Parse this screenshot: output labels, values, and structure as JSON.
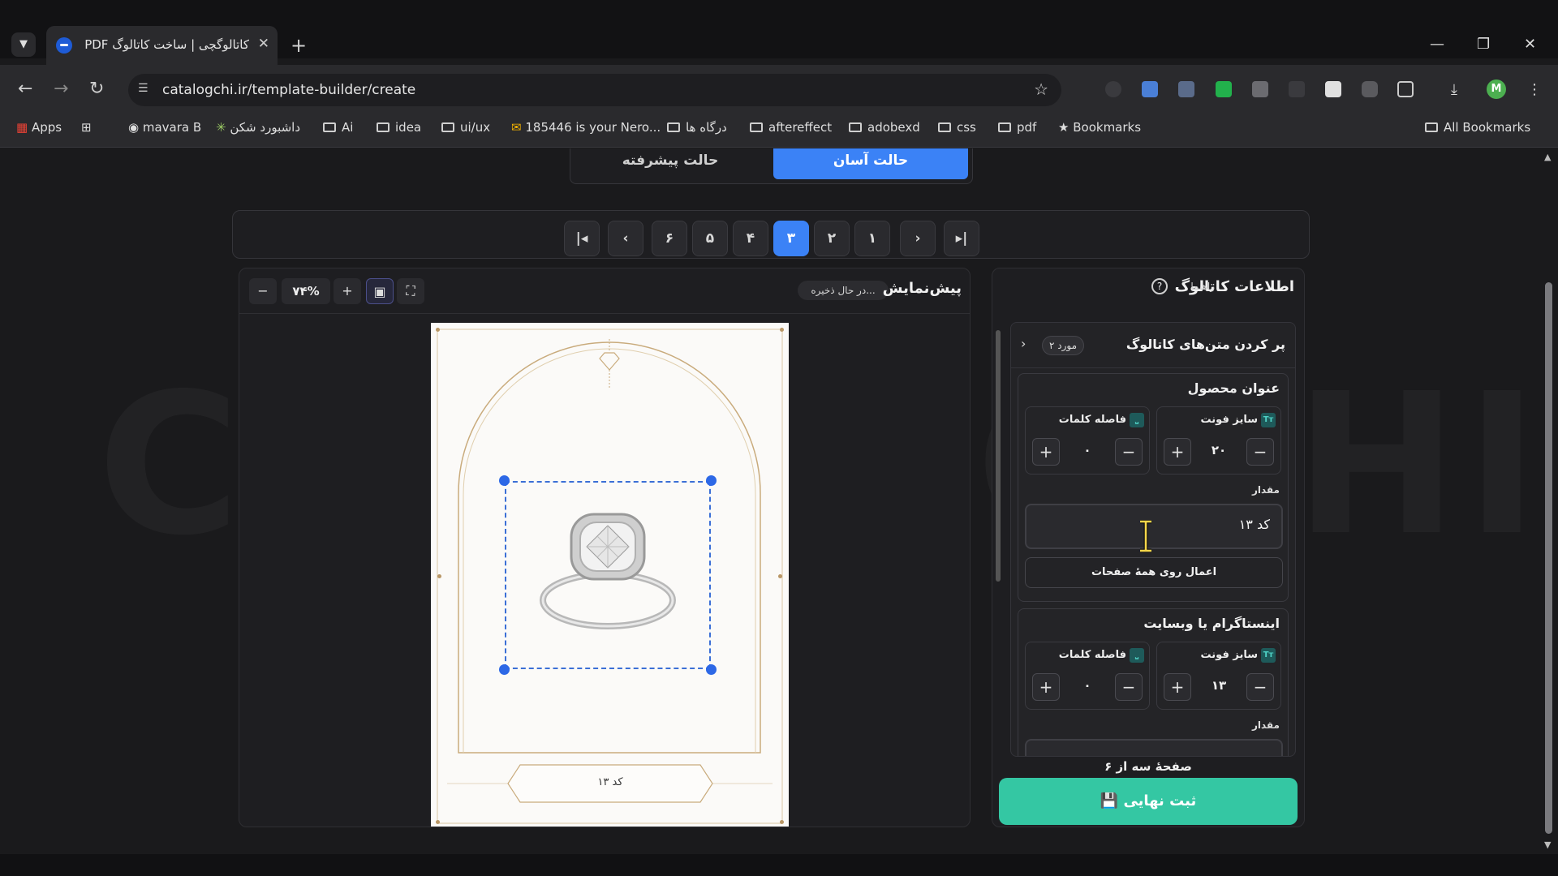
{
  "browser": {
    "tab_title": "کاتالوگچی | ساخت کاتالوگ PDF",
    "tab_close": "✕",
    "new_tab": "+",
    "url": "catalogchi.ir/template-builder/create",
    "profile_initial": "M",
    "window_controls": {
      "minimize": "—",
      "restore": "❐",
      "close": "✕"
    },
    "bookmarks": [
      {
        "label": "Apps",
        "icon": "apps-grid-icon"
      },
      {
        "label": "",
        "icon": "grid-icon"
      },
      {
        "label": "mavara B",
        "icon": "globe-icon"
      },
      {
        "label": "داشبورد شکن",
        "icon": "shekan-icon"
      },
      {
        "label": "Ai",
        "icon": "folder-icon"
      },
      {
        "label": "idea",
        "icon": "folder-icon"
      },
      {
        "label": "ui/ux",
        "icon": "folder-icon"
      },
      {
        "label": "185446 is your Nero...",
        "icon": "mail-icon"
      },
      {
        "label": "درگاه ها",
        "icon": "folder-icon"
      },
      {
        "label": "aftereffect",
        "icon": "folder-icon"
      },
      {
        "label": "adobexd",
        "icon": "folder-icon"
      },
      {
        "label": "css",
        "icon": "folder-icon"
      },
      {
        "label": "pdf",
        "icon": "folder-icon"
      },
      {
        "label": "Bookmarks",
        "icon": "star-icon"
      }
    ],
    "all_bookmarks": "All Bookmarks"
  },
  "app": {
    "watermark": "CATALOGCHI.IR",
    "mode_toggle": {
      "advanced": "حالت پیشرفته",
      "easy": "حالت آسان",
      "active": "easy"
    },
    "pager": {
      "pages": [
        "۱",
        "۲",
        "۳",
        "۴",
        "۵",
        "۶"
      ],
      "active_page": "۳"
    },
    "preview": {
      "title": "پیش‌نمایش",
      "saving_status": "در حال ذخیره...",
      "zoom": "۷۴%",
      "product_code_text": "کد ۱۳"
    },
    "side_panel": {
      "title": "اطلاعات کاتالوگ",
      "help_label": "راهنما",
      "section_title": "پر کردن متن‌های کاتالوگ",
      "items_count": "۲ مورد",
      "fields": [
        {
          "title": "عنوان محصول",
          "font_size_label": "سایز فونت",
          "font_size_value": "۲۰",
          "word_spacing_label": "فاصله کلمات",
          "word_spacing_value": "۰",
          "value_label": "مقدار",
          "value": "کد ۱۳",
          "apply_all": "اعمال روی همهٔ صفحات"
        },
        {
          "title": "اینستاگرام یا وبسایت",
          "font_size_label": "سایز فونت",
          "font_size_value": "۱۳",
          "word_spacing_label": "فاصله کلمات",
          "word_spacing_value": "۰",
          "value_label": "مقدار"
        }
      ],
      "page_info": "صفحهٔ سه از ۶",
      "submit": "ثبت نهایی"
    }
  }
}
